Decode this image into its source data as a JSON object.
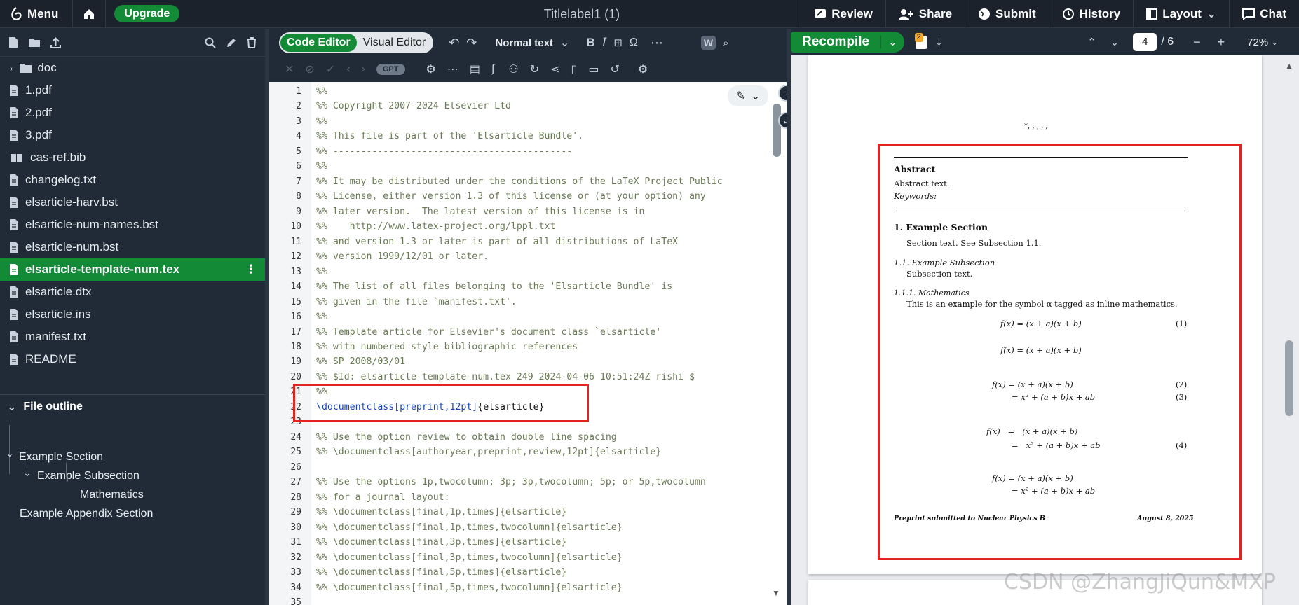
{
  "topbar": {
    "menu_label": "Menu",
    "upgrade_label": "Upgrade",
    "title": "Titlelabel1 (1)",
    "review_label": "Review",
    "share_label": "Share",
    "submit_label": "Submit",
    "history_label": "History",
    "layout_label": "Layout",
    "chat_label": "Chat"
  },
  "files": [
    {
      "name": "doc",
      "type": "folder"
    },
    {
      "name": "1.pdf",
      "type": "file"
    },
    {
      "name": "2.pdf",
      "type": "file"
    },
    {
      "name": "3.pdf",
      "type": "file"
    },
    {
      "name": "cas-ref.bib",
      "type": "bib"
    },
    {
      "name": "changelog.txt",
      "type": "file"
    },
    {
      "name": "elsarticle-harv.bst",
      "type": "file"
    },
    {
      "name": "elsarticle-num-names.bst",
      "type": "file"
    },
    {
      "name": "elsarticle-num.bst",
      "type": "file"
    },
    {
      "name": "elsarticle-template-num.tex",
      "type": "file",
      "active": true
    },
    {
      "name": "elsarticle.dtx",
      "type": "file"
    },
    {
      "name": "elsarticle.ins",
      "type": "file"
    },
    {
      "name": "manifest.txt",
      "type": "file"
    },
    {
      "name": "README",
      "type": "file"
    }
  ],
  "outline": {
    "heading": "File outline",
    "items": [
      "Example Section",
      "Example Subsection",
      "Mathematics",
      "Example Appendix Section"
    ]
  },
  "editor": {
    "mode_code": "Code Editor",
    "mode_visual": "Visual Editor",
    "text_style": "Normal text",
    "gpt_label": "GPT",
    "line_numbers": [
      "1",
      "2",
      "3",
      "4",
      "5",
      "6",
      "7",
      "8",
      "9",
      "10",
      "11",
      "12",
      "13",
      "14",
      "15",
      "16",
      "17",
      "18",
      "19",
      "20",
      "21",
      "22",
      "23",
      "24",
      "25",
      "26",
      "27",
      "28",
      "29",
      "30",
      "31",
      "32",
      "33",
      "34",
      "35"
    ],
    "lines": [
      "%%",
      "%% Copyright 2007-2024 Elsevier Ltd",
      "%%",
      "%% This file is part of the 'Elsarticle Bundle'.",
      "%% -------------------------------------------",
      "%%",
      "%% It may be distributed under the conditions of the LaTeX Project Public",
      "%% License, either version 1.3 of this license or (at your option) any",
      "%% later version.  The latest version of this license is in",
      "%%    http://www.latex-project.org/lppl.txt",
      "%% and version 1.3 or later is part of all distributions of LaTeX",
      "%% version 1999/12/01 or later.",
      "%%",
      "%% The list of all files belonging to the 'Elsarticle Bundle' is",
      "%% given in the file `manifest.txt'.",
      "%%",
      "%% Template article for Elsevier's document class `elsarticle'",
      "%% with numbered style bibliographic references",
      "%% SP 2008/03/01",
      "%% $Id: elsarticle-template-num.tex 249 2024-04-06 10:51:24Z rishi $",
      "%%",
      "",
      "",
      "%% Use the option review to obtain double line spacing",
      "%% \\documentclass[authoryear,preprint,review,12pt]{elsarticle}",
      "",
      "%% Use the options 1p,twocolumn; 3p; 3p,twocolumn; 5p; or 5p,twocolumn",
      "%% for a journal layout:",
      "%% \\documentclass[final,1p,times]{elsarticle}",
      "%% \\documentclass[final,1p,times,twocolumn]{elsarticle}",
      "%% \\documentclass[final,3p,times]{elsarticle}",
      "%% \\documentclass[final,3p,times,twocolumn]{elsarticle}",
      "%% \\documentclass[final,5p,times]{elsarticle}",
      "%% \\documentclass[final,5p,times,twocolumn]{elsarticle}",
      ""
    ],
    "line22_cmd": "\\documentclass",
    "line22_opt": "[preprint,12pt]",
    "line22_arg": "{elsarticle}"
  },
  "pdf": {
    "recompile_label": "Recompile",
    "badge_count": "2",
    "current_page": "4",
    "total_pages": "/ 6",
    "zoom": "72%",
    "top_marks": "*, , , , ,",
    "abstract_heading": "Abstract",
    "abstract_text": "Abstract text.",
    "keywords": "Keywords:",
    "section": "1.  Example Section",
    "section_text": "Section text.  See Subsection 1.1.",
    "subsection": "1.1.  Example Subsection",
    "subsection_text": "Subsection text.",
    "subsubsection": "1.1.1.  Mathematics",
    "math_text": "This is an example for the symbol α tagged as inline mathematics.",
    "eq1": "f(x) = (x + a)(x + b)",
    "eq1_tag": "(1)",
    "eq_untagged": "f(x) = (x + a)(x + b)",
    "eq2a": "f(x) = (x + a)(x + b)",
    "eq2_tag": "(2)",
    "eq2b": "= x² + (a + b)x + ab",
    "eq3_tag": "(3)",
    "eq4a": "f(x)   =   (x + a)(x + b)",
    "eq4b": "=   x² + (a + b)x + ab",
    "eq4_tag": "(4)",
    "eq5a": "f(x) = (x + a)(x + b)",
    "eq5b": "= x² + (a + b)x + ab",
    "footer_left": "Preprint submitted to Nuclear Physics B",
    "footer_right": "August 8, 2025"
  },
  "watermark": "CSDN @ZhangJiQun&MXP",
  "colors": {
    "accent": "#138a36",
    "highlight": "#e32222",
    "chrome": "#202b37"
  }
}
